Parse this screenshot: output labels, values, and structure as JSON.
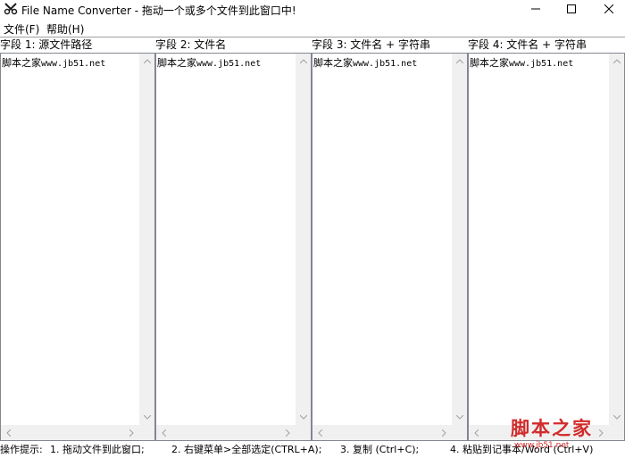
{
  "window": {
    "title": "File Name Converter - 拖动一个或多个文件到此窗口中!",
    "app_icon": "scissors-app-icon"
  },
  "menu": [
    {
      "label": "文件(F)"
    },
    {
      "label": "帮助(H)"
    }
  ],
  "columns": [
    {
      "header": "字段 1: 源文件路径",
      "content_prefix": "脚本之家",
      "content_url": "www.jb51.net"
    },
    {
      "header": "字段 2: 文件名",
      "content_prefix": "脚本之家",
      "content_url": "www.jb51.net"
    },
    {
      "header": "字段 3: 文件名  + 字符串",
      "content_prefix": "脚本之家",
      "content_url": "www.jb51.net"
    },
    {
      "header": "字段 4: 文件名 + 字符串",
      "content_prefix": "脚本之家",
      "content_url": "www.jb51.net"
    }
  ],
  "status": {
    "hint_label": "操作提示:",
    "step1": "1. 拖动文件到此窗口;",
    "step2": "2. 右键菜单>全部选定(CTRL+A);",
    "step3": "3. 复制 (Ctrl+C);",
    "step4": "4. 粘贴到记事本/Word (Ctrl+V)"
  },
  "watermark": {
    "title": "脚本之家",
    "url": "www.jb51.net"
  }
}
